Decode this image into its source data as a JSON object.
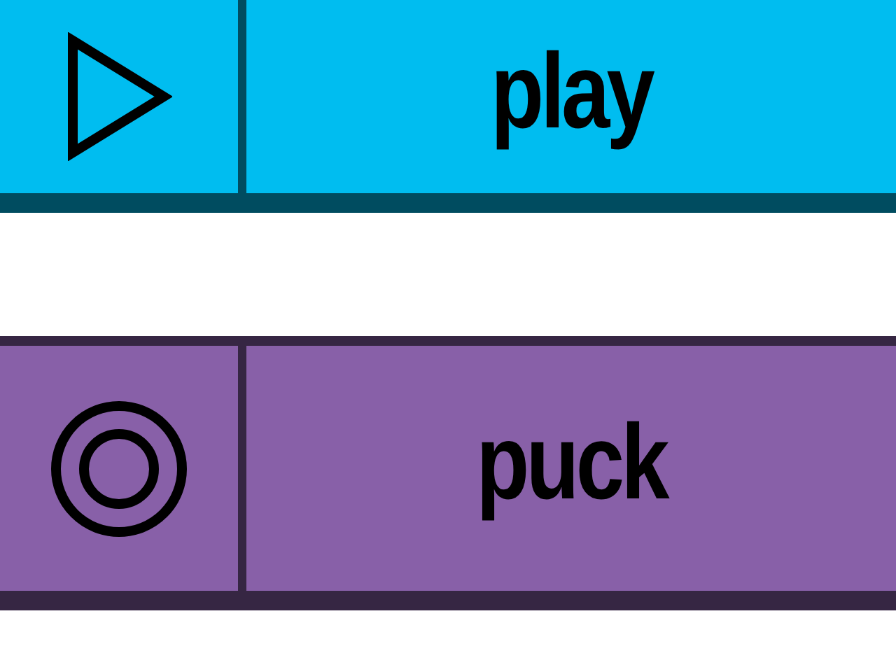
{
  "buttons": [
    {
      "kind": "play",
      "label": "play",
      "color": "#00bdf0"
    },
    {
      "kind": "target",
      "label": "puck",
      "color": "#8860a8"
    }
  ]
}
